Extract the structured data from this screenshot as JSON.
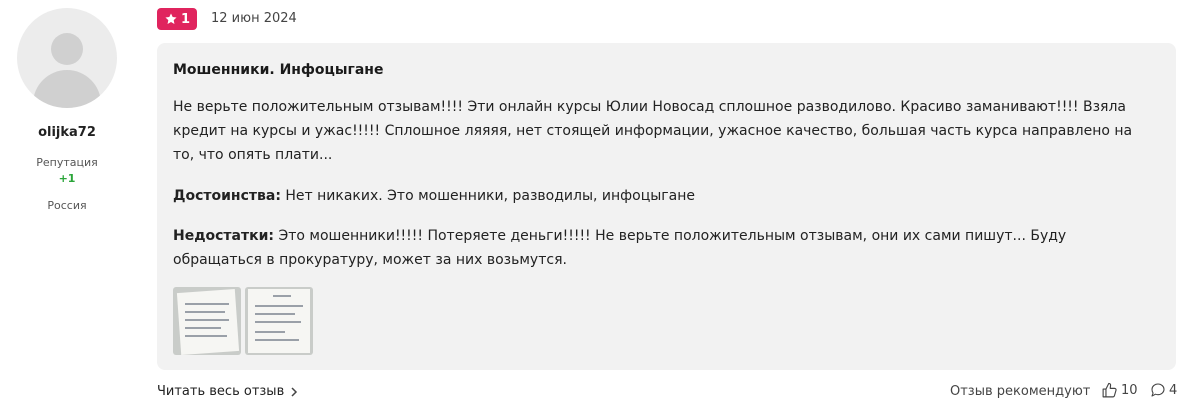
{
  "author": {
    "username": "olijka72",
    "reputation_label": "Репутация",
    "reputation_value": "+1",
    "country": "Россия"
  },
  "review": {
    "rating": "1",
    "date": "12 июн 2024",
    "title": "Мошенники. Инфоцыгане",
    "text": "Не верьте положительным отзывам!!!! Эти онлайн курсы Юлии Новосад сплошное разводилово. Красиво заманивают!!!! Взяла кредит на курсы и ужас!!!!! Сплошное ляяяя, нет стоящей информации, ужасное качество, большая часть курса направлено на то, что опять плати...",
    "pros_label": "Достоинства:",
    "pros_text": "Нет никаких. Это мошенники, разводилы, инфоцыгане",
    "cons_label": "Недостатки:",
    "cons_text": "Это мошенники!!!!! Потеряете деньги!!!!! Не верьте положительным отзывам, они их сами пишут... Буду обращаться в прокуратуру, может за них возьмутся."
  },
  "footer": {
    "read_all": "Читать весь отзыв",
    "recommend_label": "Отзыв рекомендуют",
    "likes": "10",
    "comments": "4"
  },
  "colors": {
    "rating_badge": "#e0245e",
    "card_background": "#f2f2f2",
    "reputation_positive": "#2aa539"
  },
  "icons": {
    "rating": "star-icon",
    "read_all": "chevron-right-icon",
    "likes": "thumbs-up-icon",
    "comments": "comment-bubble-icon"
  }
}
